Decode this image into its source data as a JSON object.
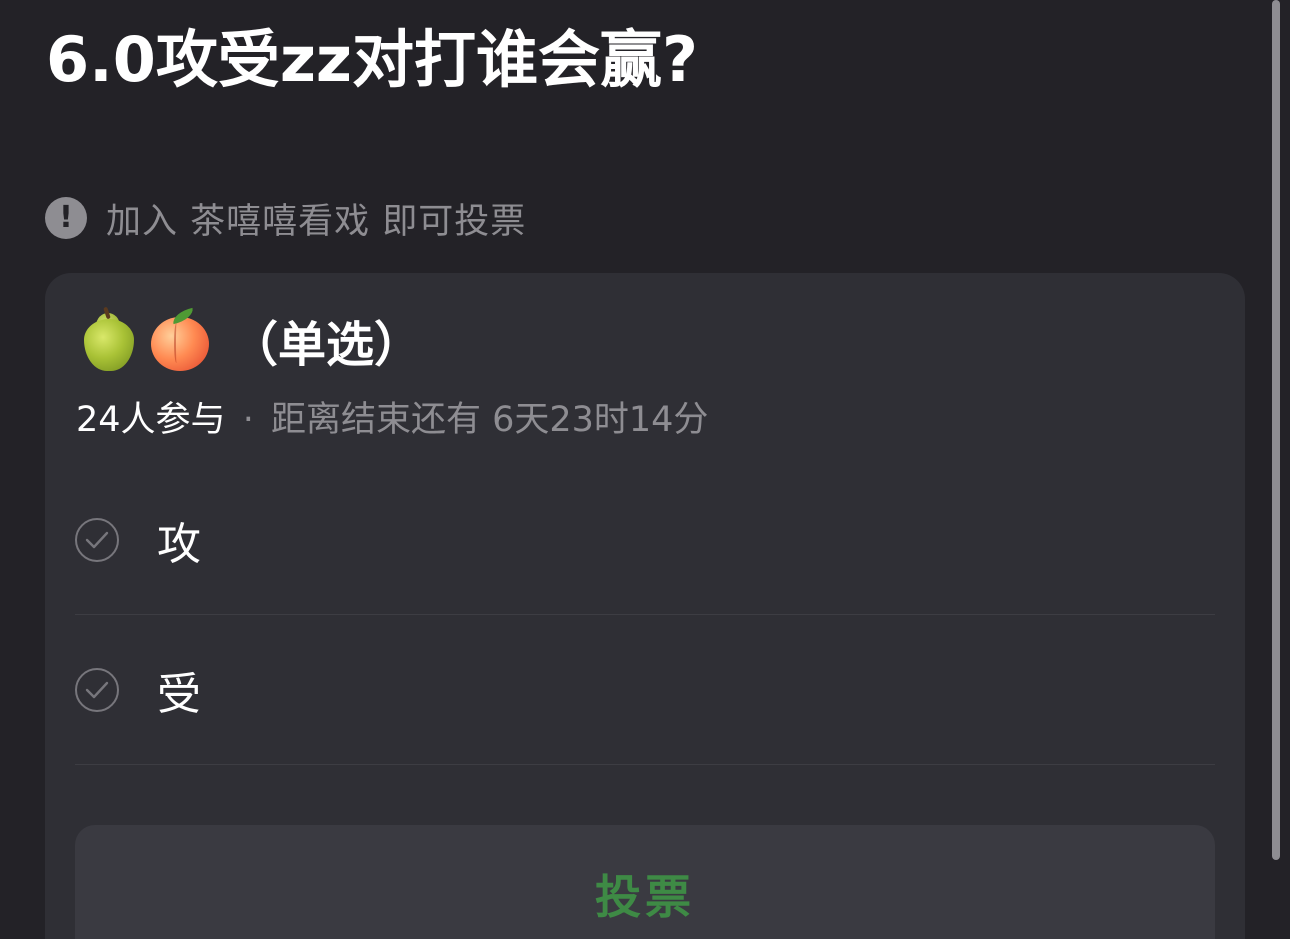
{
  "post": {
    "title": "6.0攻受zz对打谁会赢?"
  },
  "notice": {
    "icon": "exclamation-icon",
    "text": "加入 茶嘻嘻看戏 即可投票"
  },
  "poll": {
    "emoji": [
      "pear",
      "peach"
    ],
    "type_label": "（单选）",
    "participants": "24人参与",
    "separator": "·",
    "time_remaining": "距离结束还有 6天23时14分",
    "options": [
      {
        "label": "攻"
      },
      {
        "label": "受"
      }
    ],
    "vote_button_label": "投票"
  },
  "colors": {
    "background": "#232227",
    "card": "#2f2f35",
    "secondary_text": "#8e8d92",
    "vote_accent": "#3e8a45"
  }
}
